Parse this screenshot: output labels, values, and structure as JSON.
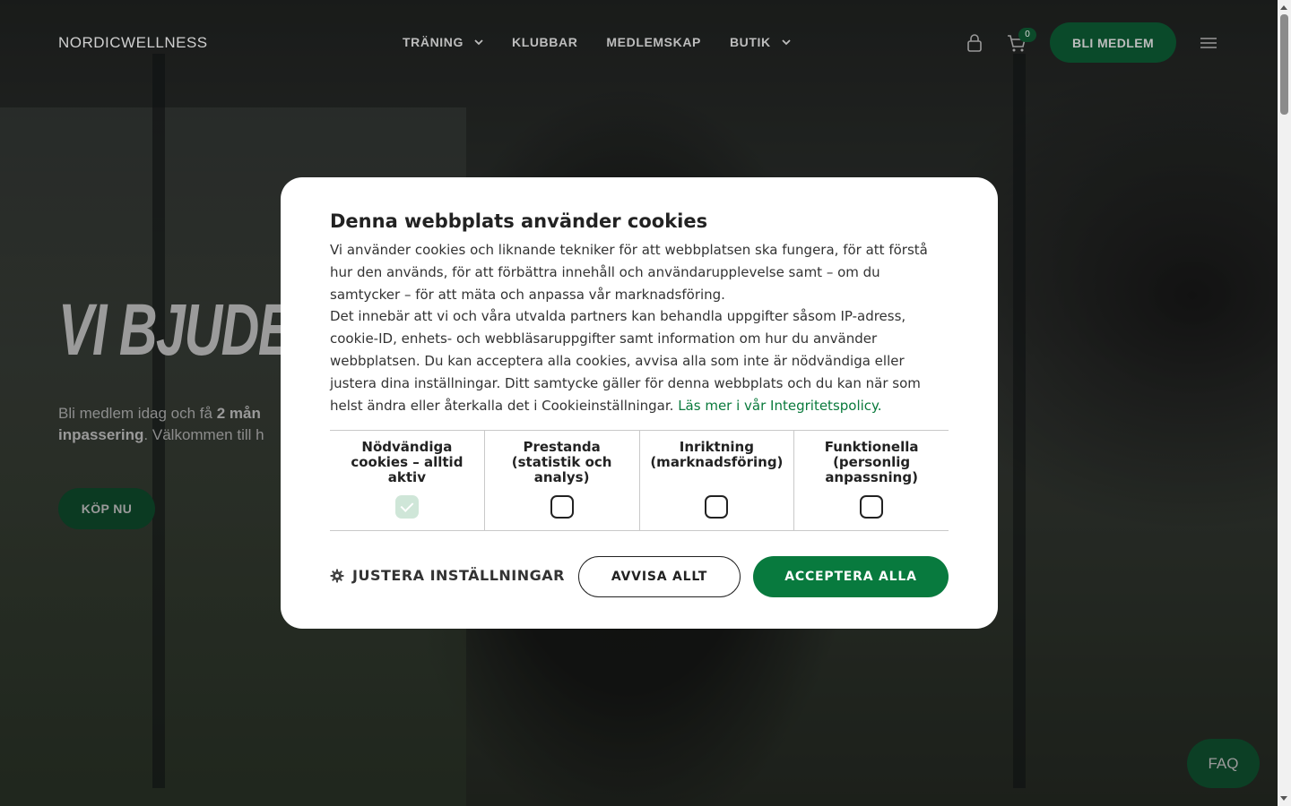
{
  "header": {
    "logo": "NORDICWELLNESS",
    "nav": [
      {
        "label": "TRÄNING",
        "has_dropdown": true
      },
      {
        "label": "KLUBBAR",
        "has_dropdown": false
      },
      {
        "label": "MEDLEMSKAP",
        "has_dropdown": false
      },
      {
        "label": "BUTIK",
        "has_dropdown": true
      }
    ],
    "cart_count": "0",
    "cta_label": "BLI MEDLEM",
    "icons": [
      "lock-icon",
      "cart-icon",
      "menu-icon"
    ]
  },
  "hero": {
    "title_visible": "VI BJUDER",
    "text_part1": "Bli medlem idag och få ",
    "text_bold1": "2 mån",
    "text_bold2": "inpassering",
    "text_part2": ". Välkommen till h",
    "button_label": "KÖP NU"
  },
  "cookie_dialog": {
    "title": "Denna webbplats använder cookies",
    "paragraph1": "Vi använder cookies och liknande tekniker för att webbplatsen ska fungera, för att förstå hur den används, för att förbättra innehåll och användarupplevelse samt – om du samtycker – för att mäta och anpassa vår marknadsföring.",
    "paragraph2": "Det innebär att vi och våra utvalda partners kan behandla uppgifter såsom IP-adress, cookie-ID, enhets- och webbläsaruppgifter samt information om hur du använder webbplatsen. Du kan acceptera alla cookies, avvisa alla som inte är nödvändiga eller justera dina inställningar. Ditt samtycke gäller för denna webbplats och du kan när som helst ändra eller återkalla det i Cookieinställningar.",
    "policy_link": "Läs mer i vår Integritetspolicy.",
    "categories": [
      {
        "label": "Nödvändiga cookies – alltid aktiv",
        "checked": true,
        "disabled": true
      },
      {
        "label": "Prestanda (statistik och analys)",
        "checked": false,
        "disabled": false
      },
      {
        "label": "Inriktning (marknadsföring)",
        "checked": false,
        "disabled": false
      },
      {
        "label": "Funktionella (personlig anpassning)",
        "checked": false,
        "disabled": false
      }
    ],
    "adjust_label": "JUSTERA INSTÄLLNINGAR",
    "reject_label": "AVVISA ALLT",
    "accept_label": "ACCEPTERA ALLA",
    "accent_color": "#087a3e"
  },
  "faq_label": "FAQ"
}
